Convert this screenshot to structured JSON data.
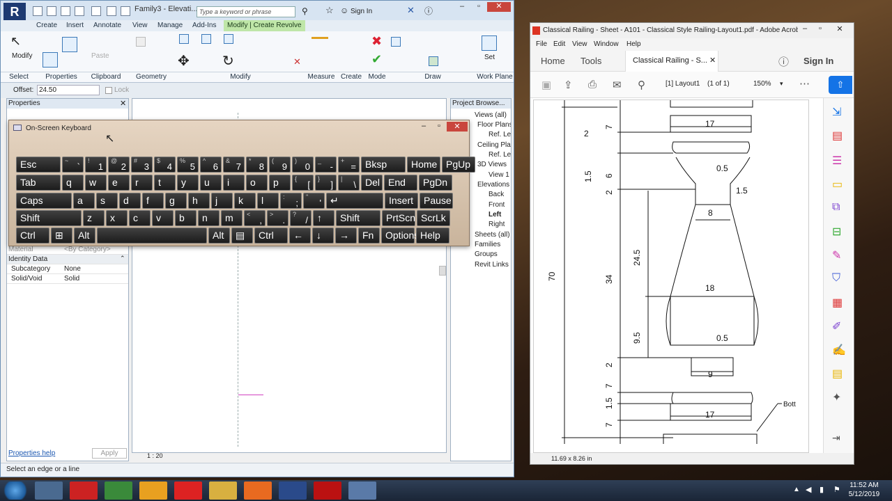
{
  "revit": {
    "doc_title": "Family3 - Elevati...",
    "search_placeholder": "Type a keyword or phrase",
    "sign_in": "Sign In",
    "tabs": [
      "Create",
      "Insert",
      "Annotate",
      "View",
      "Manage",
      "Add-Ins",
      "Modify | Create Revolve"
    ],
    "groups": [
      "Select",
      "Properties",
      "Clipboard",
      "Geometry",
      "Modify",
      "Measure",
      "Create",
      "Mode",
      "Draw",
      "Work Plane"
    ],
    "modify_label": "Modify",
    "properties_label": "Properties",
    "paste_label": "Paste",
    "set_label": "Set",
    "offset_label": "Offset:",
    "offset_value": "24.50",
    "lock_label": "Lock",
    "props_title": "Properties",
    "prop_material": "Material",
    "prop_material_value": "<By Category>",
    "prop_identity": "Identity Data",
    "prop_rows": [
      {
        "k": "Subcategory",
        "v": "None"
      },
      {
        "k": "Solid/Void",
        "v": "Solid"
      }
    ],
    "props_help": "Properties help",
    "apply": "Apply",
    "scale": "1 : 20",
    "status": "Select an edge or a line",
    "browser_title": "Project Browse...",
    "browser": [
      "Views (all)",
      "Floor Plans",
      "Ref. Lev",
      "Ceiling Plan",
      "Ref. Lev",
      "3D Views",
      "View 1",
      "Elevations (",
      "Back",
      "Front",
      "Left",
      "Right",
      "Sheets (all)",
      "Families",
      "Groups",
      "Revit Links"
    ]
  },
  "osk": {
    "title": "On-Screen Keyboard",
    "row1": [
      {
        "s": "",
        "m": "Esc"
      },
      {
        "s": "~",
        "m": "`"
      },
      {
        "s": "!",
        "m": "1"
      },
      {
        "s": "@",
        "m": "2"
      },
      {
        "s": "#",
        "m": "3"
      },
      {
        "s": "$",
        "m": "4"
      },
      {
        "s": "%",
        "m": "5"
      },
      {
        "s": "^",
        "m": "6"
      },
      {
        "s": "&",
        "m": "7"
      },
      {
        "s": "*",
        "m": "8"
      },
      {
        "s": "(",
        "m": "9"
      },
      {
        "s": ")",
        "m": "0"
      },
      {
        "s": "_",
        "m": "-"
      },
      {
        "s": "+",
        "m": "="
      },
      {
        "s": "",
        "m": "Bksp"
      },
      {
        "s": "",
        "m": "Home"
      },
      {
        "s": "",
        "m": "PgUp"
      }
    ],
    "row2": [
      {
        "s": "",
        "m": "Tab"
      },
      {
        "s": "",
        "m": "q"
      },
      {
        "s": "",
        "m": "w"
      },
      {
        "s": "",
        "m": "e"
      },
      {
        "s": "",
        "m": "r"
      },
      {
        "s": "",
        "m": "t"
      },
      {
        "s": "",
        "m": "y"
      },
      {
        "s": "",
        "m": "u"
      },
      {
        "s": "",
        "m": "i"
      },
      {
        "s": "",
        "m": "o"
      },
      {
        "s": "",
        "m": "p"
      },
      {
        "s": "{",
        "m": "["
      },
      {
        "s": "}",
        "m": "]"
      },
      {
        "s": "|",
        "m": "\\"
      },
      {
        "s": "",
        "m": "Del"
      },
      {
        "s": "",
        "m": "End"
      },
      {
        "s": "",
        "m": "PgDn"
      }
    ],
    "row3": [
      {
        "s": "",
        "m": "Caps"
      },
      {
        "s": "",
        "m": "a"
      },
      {
        "s": "",
        "m": "s"
      },
      {
        "s": "",
        "m": "d"
      },
      {
        "s": "",
        "m": "f"
      },
      {
        "s": "",
        "m": "g"
      },
      {
        "s": "",
        "m": "h"
      },
      {
        "s": "",
        "m": "j"
      },
      {
        "s": "",
        "m": "k"
      },
      {
        "s": "",
        "m": "l"
      },
      {
        "s": ":",
        "m": ";"
      },
      {
        "s": "\"",
        "m": "'"
      },
      {
        "s": "",
        "m": "↵"
      },
      {
        "s": "",
        "m": "Insert"
      },
      {
        "s": "",
        "m": "Pause"
      }
    ],
    "row4": [
      {
        "s": "",
        "m": "Shift"
      },
      {
        "s": "",
        "m": "z"
      },
      {
        "s": "",
        "m": "x"
      },
      {
        "s": "",
        "m": "c"
      },
      {
        "s": "",
        "m": "v"
      },
      {
        "s": "",
        "m": "b"
      },
      {
        "s": "",
        "m": "n"
      },
      {
        "s": "",
        "m": "m"
      },
      {
        "s": "<",
        "m": ","
      },
      {
        "s": ">",
        "m": "."
      },
      {
        "s": "?",
        "m": "/"
      },
      {
        "s": "",
        "m": "↑"
      },
      {
        "s": "",
        "m": "Shift"
      },
      {
        "s": "",
        "m": "PrtScn"
      },
      {
        "s": "",
        "m": "ScrLk"
      }
    ],
    "row5": [
      {
        "s": "",
        "m": "Ctrl"
      },
      {
        "s": "",
        "m": "⊞"
      },
      {
        "s": "",
        "m": "Alt"
      },
      {
        "s": "",
        "m": ""
      },
      {
        "s": "",
        "m": "Alt"
      },
      {
        "s": "",
        "m": "▤"
      },
      {
        "s": "",
        "m": "Ctrl"
      },
      {
        "s": "",
        "m": "←"
      },
      {
        "s": "",
        "m": "↓"
      },
      {
        "s": "",
        "m": "→"
      },
      {
        "s": "",
        "m": "Fn"
      },
      {
        "s": "",
        "m": "Options"
      },
      {
        "s": "",
        "m": "Help"
      }
    ]
  },
  "acrobat": {
    "title": "Classical Railing - Sheet - A101 - Classical Style Railing-Layout1.pdf - Adobe Acrob...",
    "menu": [
      "File",
      "Edit",
      "View",
      "Window",
      "Help"
    ],
    "tabs": [
      "Home",
      "Tools"
    ],
    "doc_tab": "Classical Railing - S...",
    "sign_in": "Sign In",
    "page_field": "[1] Layout1",
    "page_of": "(1 of 1)",
    "zoom": "150%",
    "page_size": "11.69 x 8.26 in",
    "dims": {
      "d70": "70",
      "d34": "34",
      "d245": "24.5",
      "d95": "9.5",
      "d17a": "17",
      "d7a": "7",
      "d2a": "2",
      "d15a": "1.5",
      "d6": "6",
      "d2b": "2",
      "d05a": "0.5",
      "d15b": "1.5",
      "d8": "8",
      "d18": "18",
      "d05b": "0.5",
      "d2c": "2",
      "d9": "9",
      "d7b": "7",
      "d15c": "1.5",
      "d7c": "7",
      "d17b": "17",
      "d2top": "2",
      "bott": "Bott"
    }
  },
  "clock": {
    "time": "11:52 AM",
    "date": "5/12/2019"
  }
}
